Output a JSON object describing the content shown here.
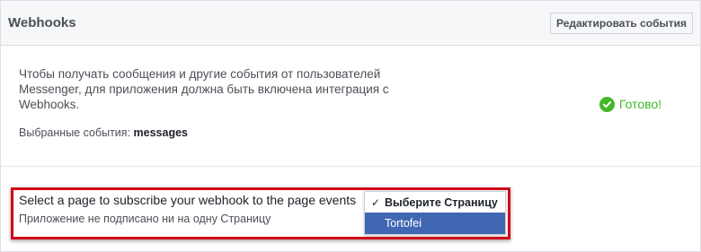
{
  "header": {
    "title": "Webhooks",
    "edit_button_label": "Редактировать события"
  },
  "info": {
    "description": "Чтобы получать сообщения и другие события от пользователей Messenger, для приложения должна быть включена интеграция с Webhooks.",
    "selected_events_label": "Выбранные события:",
    "selected_events_value": "messages",
    "status_text": "Готово!",
    "status_icon": "check-circle-icon",
    "status_color": "#42b72a"
  },
  "subscription": {
    "prompt": "Select a page to subscribe your webhook to the page events",
    "status": "Приложение не подписано ни на одну Страницу",
    "dropdown": {
      "options": [
        "Выберите Страницу",
        "Tortofei"
      ],
      "selected": "Выберите Страницу",
      "highlighted": "Tortofei",
      "check_glyph": "✓"
    },
    "highlight_color": "#d0021b",
    "accent_color": "#4267b2"
  }
}
